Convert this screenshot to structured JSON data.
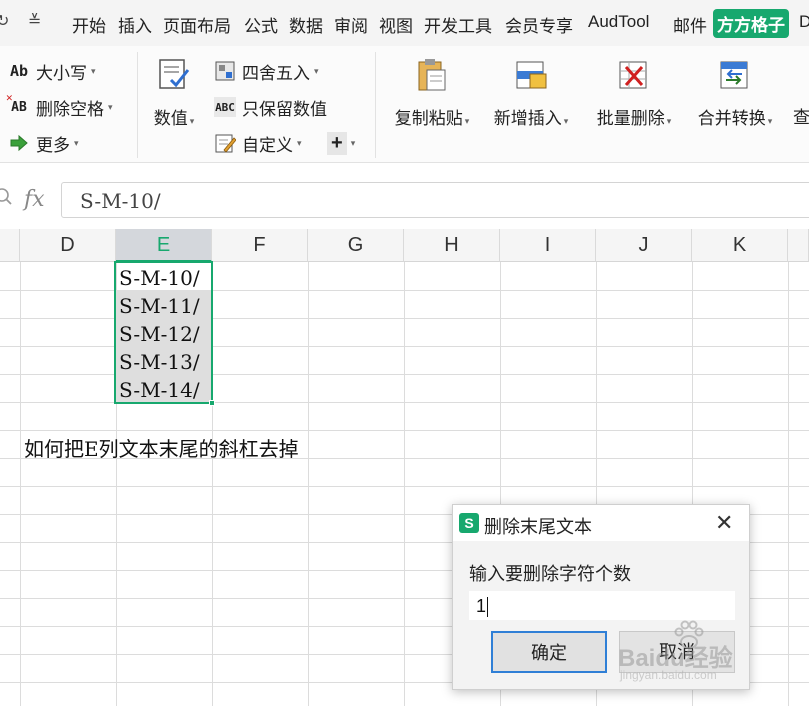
{
  "menubar": {
    "corner_icons": [
      "↻",
      "≚"
    ],
    "tabs": [
      {
        "label": "开始"
      },
      {
        "label": "插入"
      },
      {
        "label": "页面布局"
      },
      {
        "label": "公式"
      },
      {
        "label": "数据"
      },
      {
        "label": "审阅"
      },
      {
        "label": "视图"
      },
      {
        "label": "开发工具"
      },
      {
        "label": "会员专享"
      },
      {
        "label": "AudTool"
      },
      {
        "label": "邮件"
      },
      {
        "label": "方方格子",
        "active": true
      },
      {
        "label": "D"
      }
    ],
    "accent_color": "#17a86e"
  },
  "ribbon": {
    "case_button": "大小写",
    "case_icon_text": "Ab",
    "remove_spaces_button": "删除空格",
    "remove_spaces_icon_text": "AB",
    "more_button": "更多",
    "number_button": "数值",
    "round_button": "四舍五入",
    "keep_numbers_button": "只保留数值",
    "keep_numbers_icon_text": "ABC",
    "custom_button": "自定义",
    "plus_button": "+",
    "paste_button": "复制粘贴",
    "insert_button": "新增插入",
    "delete_button": "批量删除",
    "merge_button": "合并转换",
    "find_button": "查"
  },
  "formula_bar": {
    "fx_label": "fx",
    "value": "S-M-10/"
  },
  "grid": {
    "columns": [
      "D",
      "E",
      "F",
      "G",
      "H",
      "I",
      "J",
      "K"
    ],
    "selected_column": "E",
    "e_cells": [
      "S-M-10/",
      "S-M-11/",
      "S-M-12/",
      "S-M-13/",
      "S-M-14/"
    ],
    "note": "如何把E列文本末尾的斜杠去掉",
    "selection_color": "#17a86e"
  },
  "dialog": {
    "logo": "S",
    "title": "删除末尾文本",
    "close_icon": "✕",
    "prompt": "输入要删除字符个数",
    "input_value": "1",
    "ok_button": "确定",
    "cancel_button": "取消"
  },
  "watermark": {
    "text": "Baidu经验",
    "url": "jingyan.baidu.com"
  }
}
